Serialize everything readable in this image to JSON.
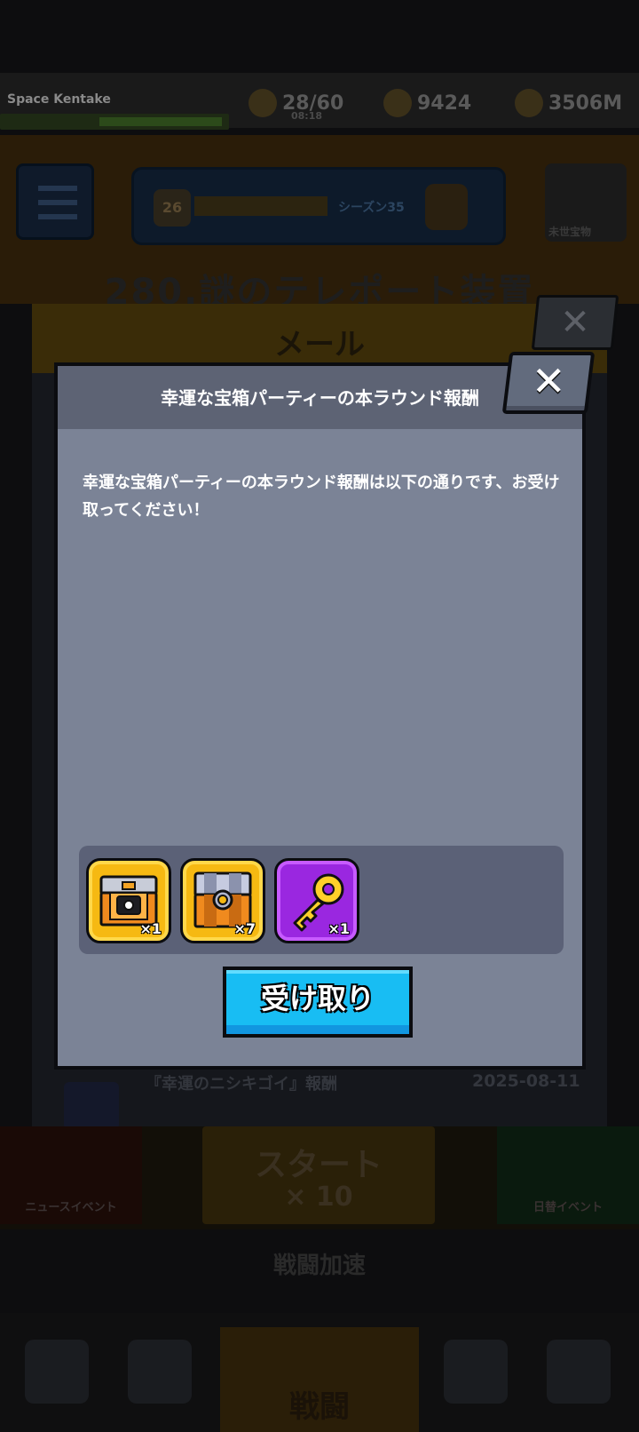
{
  "background": {
    "player_name": "Space Kentake",
    "stamina": "28/60",
    "stamina_timer": "08:18",
    "gems": "9424",
    "coins": "3506M",
    "season_level": "26",
    "season_label": "シーズン35",
    "right_button_label": "未世宝物",
    "stage_title": "280.謎のテレポート装置",
    "mail_title": "メール",
    "mail_close": "✕",
    "mail_row_text": "『幸運のニシキゴイ』報酬",
    "mail_row_date": "2025-08-11",
    "start_label": "スタート",
    "start_cost": "× 10",
    "left_event_label": "ニュースイベント",
    "right_event_label": "日替イベント",
    "speed_label": "戦闘加速",
    "nav_center_label": "戦闘"
  },
  "dialog": {
    "title": "幸運な宝箱パーティーの本ラウンド報酬",
    "close": "✕",
    "message": "幸運な宝箱パーティーの本ラウンド報酬は以下の通りです、お受け取ってください！",
    "rewards": [
      {
        "icon": "chest-black-icon",
        "qty": "×1"
      },
      {
        "icon": "chest-silver-icon",
        "qty": "×7"
      },
      {
        "icon": "gold-key-icon",
        "qty": "×1"
      }
    ],
    "claim_label": "受け取り"
  },
  "colors": {
    "dialog_bg": "#7b8396",
    "dialog_header": "#5d6374",
    "claim_button": "#18bdf3",
    "gold_frame": "#f6b912",
    "purple_frame": "#9a27e0"
  }
}
